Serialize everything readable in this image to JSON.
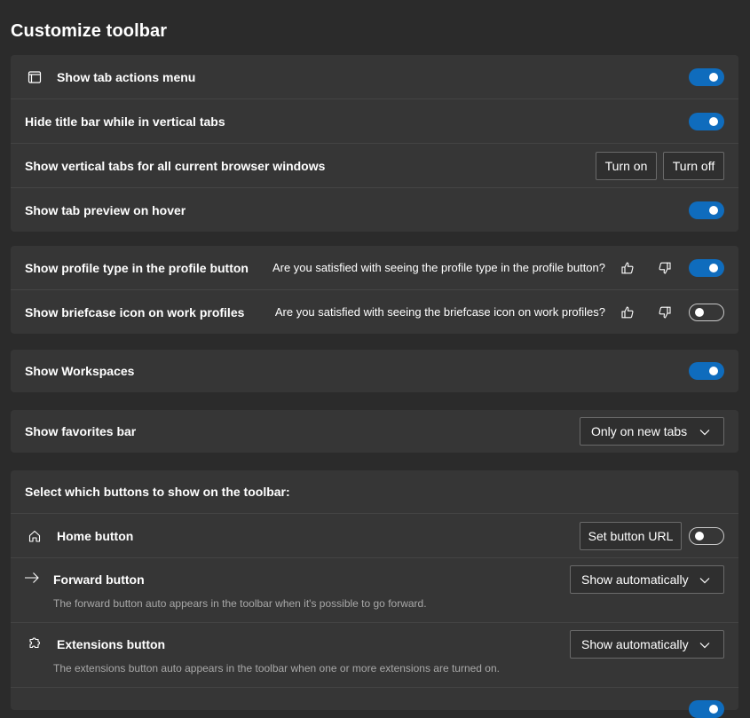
{
  "page_title": "Customize toolbar",
  "accent_color": "#0f6cbd",
  "card1": {
    "tab_actions_menu": {
      "label": "Show tab actions menu",
      "icon": "tab-actions-icon",
      "enabled": true
    },
    "hide_title_bar": {
      "label": "Hide title bar while in vertical tabs",
      "enabled": true
    },
    "vertical_tabs_all": {
      "label": "Show vertical tabs for all current browser windows",
      "turn_on": "Turn on",
      "turn_off": "Turn off"
    },
    "tab_preview": {
      "label": "Show tab preview on hover",
      "enabled": true
    }
  },
  "card2": {
    "profile_type": {
      "label": "Show profile type in the profile button",
      "question": "Are you satisfied with seeing the profile type in the profile button?",
      "enabled": true
    },
    "briefcase": {
      "label": "Show briefcase icon on work profiles",
      "question": "Are you satisfied with seeing the briefcase icon on work profiles?",
      "enabled": false
    }
  },
  "card3": {
    "workspaces": {
      "label": "Show Workspaces",
      "enabled": true
    }
  },
  "card4": {
    "favorites_bar": {
      "label": "Show favorites bar",
      "selected": "Only on new tabs"
    }
  },
  "card5": {
    "heading": "Select which buttons to show on the toolbar:",
    "home": {
      "label": "Home button",
      "icon": "home-icon",
      "set_url": "Set button URL",
      "enabled": false
    },
    "forward": {
      "label": "Forward button",
      "icon": "forward-arrow-icon",
      "selected": "Show automatically",
      "description": "The forward button auto appears in the toolbar when it's possible to go forward."
    },
    "extensions": {
      "label": "Extensions button",
      "icon": "extensions-puzzle-icon",
      "selected": "Show automatically",
      "description": "The extensions button auto appears in the toolbar when one or more extensions are turned on."
    }
  }
}
